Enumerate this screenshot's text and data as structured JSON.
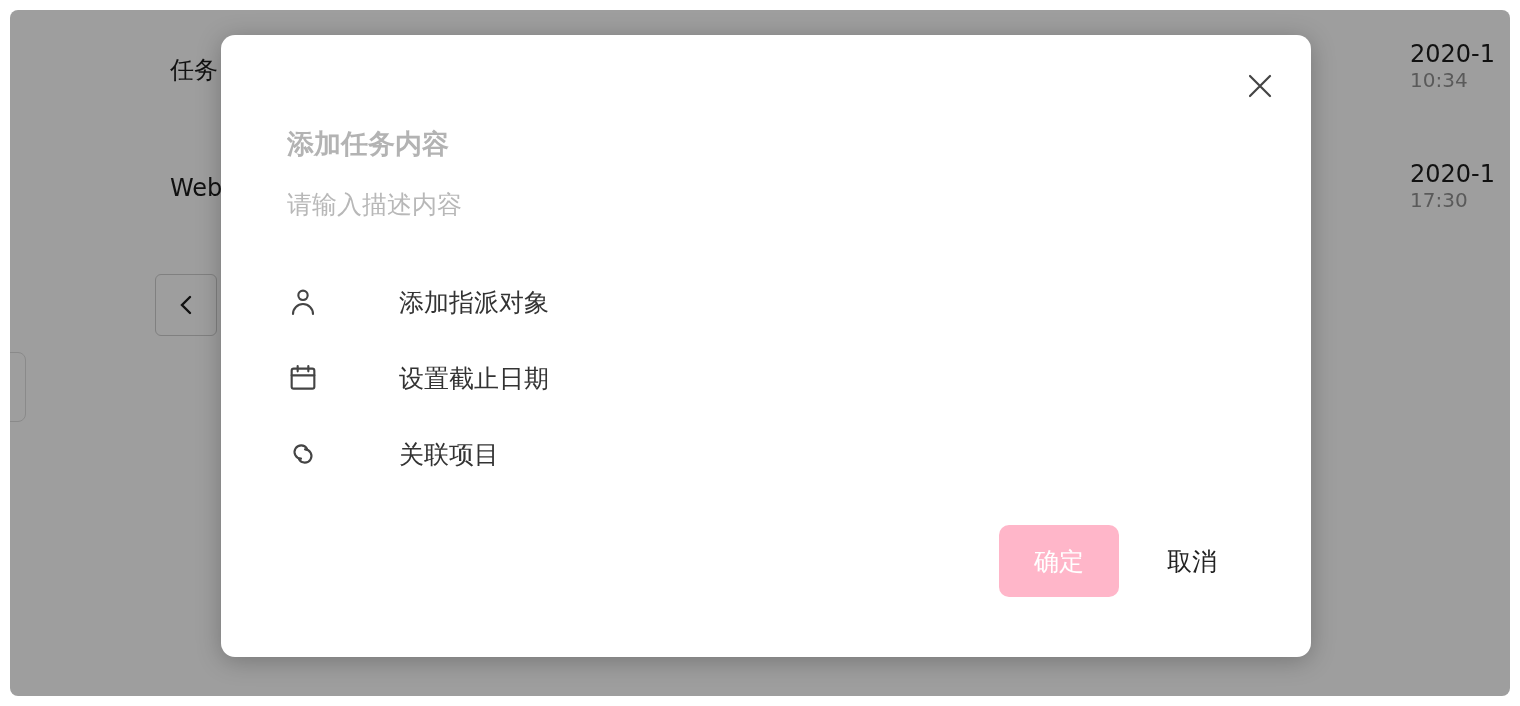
{
  "background": {
    "rows": [
      {
        "title": "任务",
        "date": "2020-1",
        "time": "10:34"
      },
      {
        "title": "Web",
        "date": "2020-1",
        "time": "17:30"
      }
    ]
  },
  "dialog": {
    "title": {
      "placeholder": "添加任务内容"
    },
    "description": {
      "placeholder": "请输入描述内容"
    },
    "options": [
      {
        "kind": "person",
        "label": "添加指派对象"
      },
      {
        "kind": "calendar",
        "label": "设置截止日期"
      },
      {
        "kind": "link",
        "label": "关联项目"
      }
    ],
    "buttons": {
      "confirm": {
        "label": "确定",
        "disabled": true
      },
      "cancel": {
        "label": "取消"
      }
    }
  }
}
